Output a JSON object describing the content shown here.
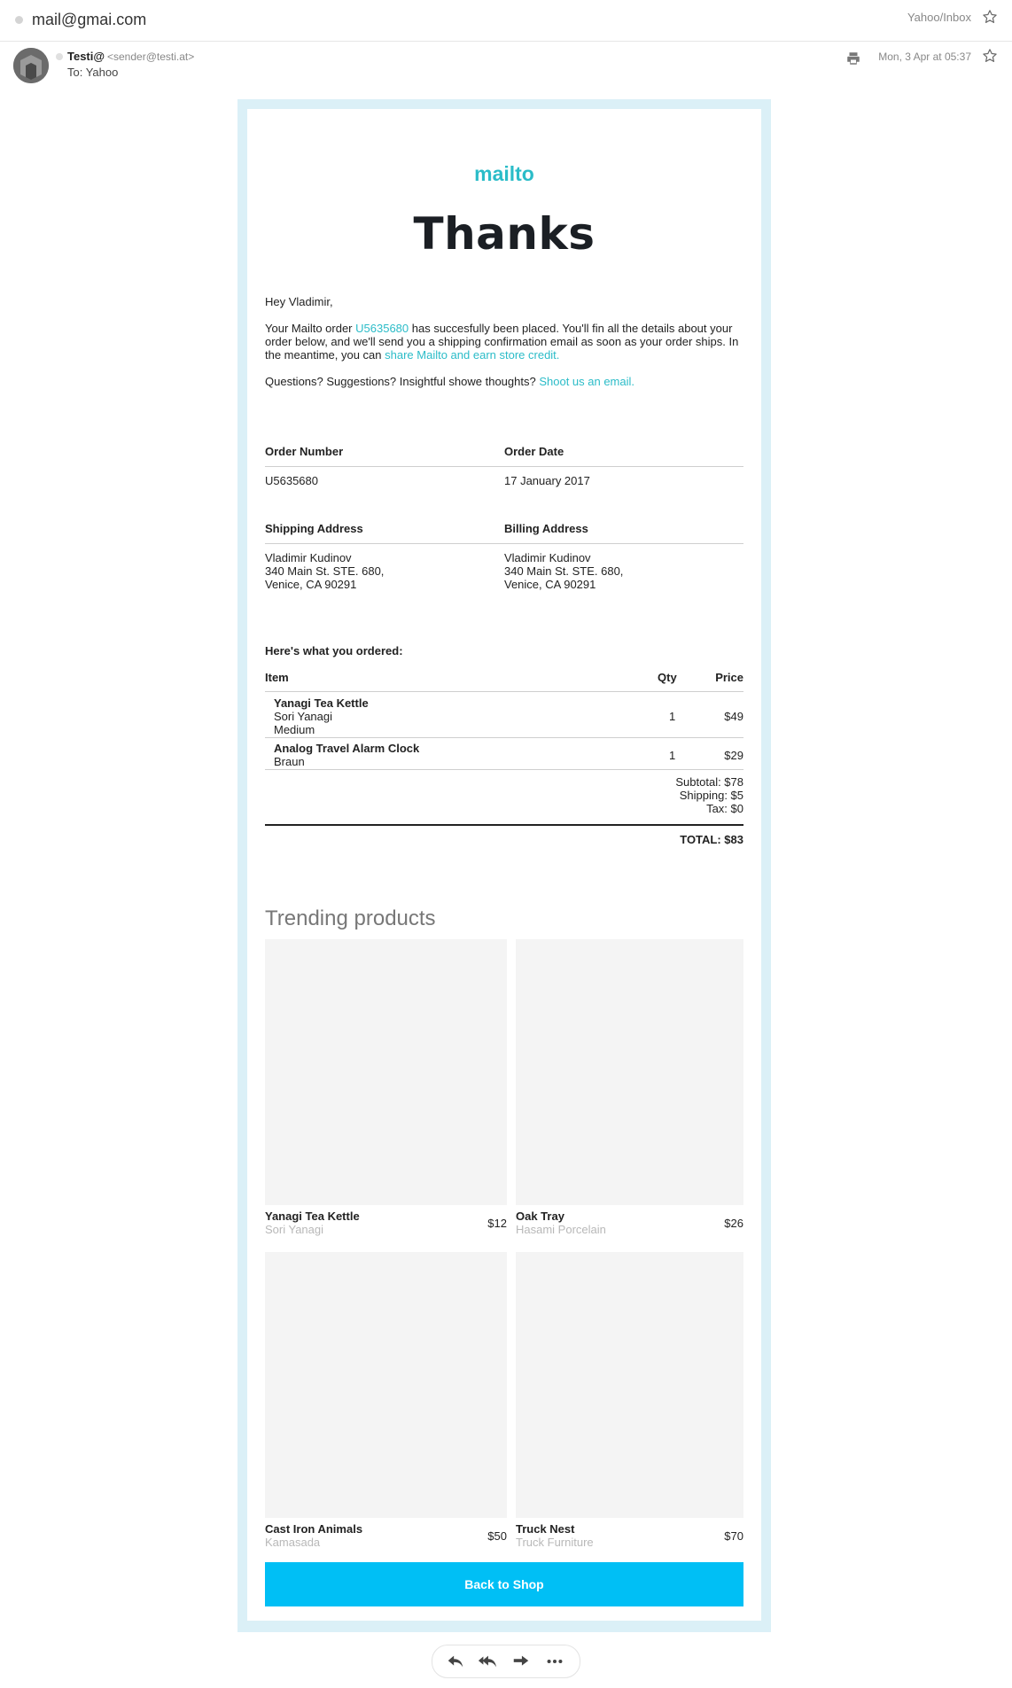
{
  "mail": {
    "account": "mail@gmai.com",
    "folder": "Yahoo/Inbox",
    "sender_name": "Testi@",
    "sender_email": "<sender@testi.at>",
    "to": "To: Yahoo",
    "date": "Mon, 3 Apr at 05:37"
  },
  "email": {
    "brand": "mailto",
    "heading": "Thanks",
    "greeting": "Hey Vladimir,",
    "intro_1": "Your Mailto order ",
    "order_link": "U5635680",
    "intro_2": " has succesfully been placed. You'll fin all the details about your order below, and we'll send you a shipping confirmation email as soon as your order ships. In the meantime, you can ",
    "share_link": "share Mailto and earn store credit.",
    "questions": "Questions? Suggestions? Insightful showe thoughts? ",
    "contact_link": "Shoot us an email.",
    "order_number_label": "Order Number",
    "order_number": "U5635680",
    "order_date_label": "Order Date",
    "order_date": "17 January 2017",
    "shipping_label": "Shipping Address",
    "billing_label": "Billing Address",
    "shipping": {
      "name": "Vladimir Kudinov",
      "line1": "340 Main St. STE. 680,",
      "line2": "Venice, CA 90291"
    },
    "billing": {
      "name": "Vladimir Kudinov",
      "line1": "340 Main St. STE. 680,",
      "line2": "Venice, CA 90291"
    },
    "ordered_heading": "Here's what you ordered:",
    "table_headers": {
      "item": "Item",
      "qty": "Qty",
      "price": "Price"
    },
    "items": [
      {
        "name": "Yanagi Tea Kettle",
        "brand": "Sori Yanagi",
        "variant": "Medium",
        "qty": "1",
        "price": "$49"
      },
      {
        "name": "Analog Travel Alarm Clock",
        "brand": "Braun",
        "variant": "",
        "qty": "1",
        "price": "$29"
      }
    ],
    "subtotal": "Subtotal: $78",
    "shipping_cost": "Shipping: $5",
    "tax": "Tax: $0",
    "total": "TOTAL: $83",
    "trending_title": "Trending products",
    "trending": [
      {
        "name": "Yanagi Tea Kettle",
        "brand": "Sori Yanagi",
        "price": "$12"
      },
      {
        "name": "Oak Tray",
        "brand": "Hasami Porcelain",
        "price": "$26"
      },
      {
        "name": "Cast Iron Animals",
        "brand": "Kamasada",
        "price": "$50"
      },
      {
        "name": "Truck Nest",
        "brand": "Truck Furniture",
        "price": "$70"
      }
    ],
    "button": "Back to Shop"
  },
  "actions": {
    "icons": [
      "reply-icon",
      "reply-all-icon",
      "forward-icon",
      "more-icon"
    ]
  },
  "colors": {
    "accent": "#2bbcc8",
    "button": "#00bff5",
    "frame": "#dbf0f7"
  }
}
